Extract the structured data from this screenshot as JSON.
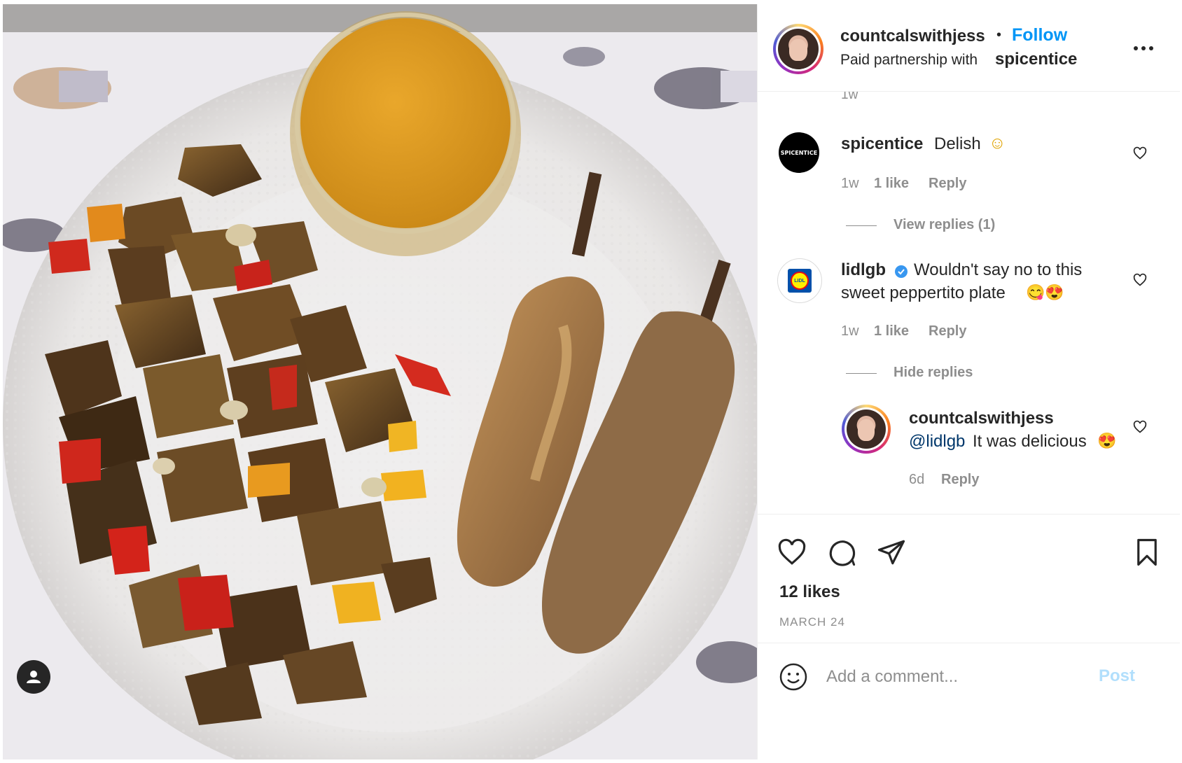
{
  "header": {
    "username": "countcalswithjess",
    "separator": "•",
    "follow_label": "Follow",
    "partnership_prefix": "Paid partnership with",
    "partner": "spicentice",
    "more_icon": "ellipsis-icon"
  },
  "caption_time": "1w",
  "comments": [
    {
      "username": "spicentice",
      "avatar_text": "SPICENTICE",
      "text": "Delish",
      "emoji": "☺",
      "time": "1w",
      "likes": "1 like",
      "reply_label": "Reply",
      "replies_toggle": "View replies (1)"
    },
    {
      "username": "lidlgb",
      "avatar_text": "LIDL",
      "verified": true,
      "text_line1": "Wouldn't say no to this",
      "text_line2": "sweet peppertito plate",
      "emoji": "😋😍",
      "time": "1w",
      "likes": "1 like",
      "reply_label": "Reply",
      "replies_toggle": "Hide replies",
      "reply": {
        "username": "countcalswithjess",
        "mention": "@lidlgb",
        "text": "It was delicious",
        "emoji": "😍",
        "time": "6d",
        "reply_label": "Reply"
      }
    }
  ],
  "actions": {
    "like_icon": "heart-icon",
    "comment_icon": "comment-icon",
    "share_icon": "send-icon",
    "save_icon": "bookmark-icon"
  },
  "likes_count": "12 likes",
  "date": "MARCH 24",
  "comment_box": {
    "emoji_icon": "smiley-icon",
    "placeholder": "Add a comment...",
    "post_label": "Post"
  },
  "colors": {
    "accent": "#0095f6",
    "post_disabled": "#b2dffc",
    "mention": "#00376b",
    "muted": "#8e8e8e"
  },
  "photo_overlay_icon": "user-tag-icon"
}
